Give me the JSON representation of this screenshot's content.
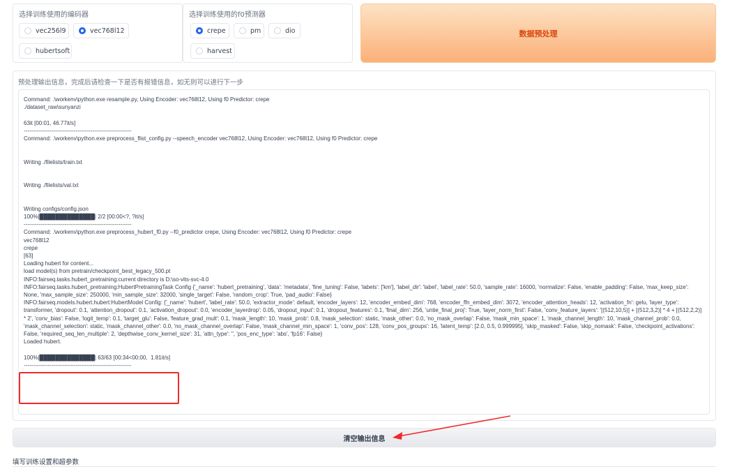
{
  "encoder_group": {
    "label": "选择训练使用的编码器",
    "options": [
      "vec256l9",
      "vec768l12",
      "hubertsoft"
    ],
    "selected": "vec768l12"
  },
  "f0_group": {
    "label": "选择训练使用的f0预测器",
    "options": [
      "crepe",
      "pm",
      "dio",
      "harvest"
    ],
    "selected": "crepe"
  },
  "preprocess_button": {
    "label": "数据预处理"
  },
  "output": {
    "label": "预处理输出信息，完成后请检查一下是否有报错信息，如无则可以进行下一步",
    "log": "Command: .\\workenv\\python.exe resample.py, Using Encoder: vec768l12, Using f0 Predictor: crepe\n./dataset_raw\\sunyanzi\n\n63it [00:01, 46.77it/s]\n----------------------------------------------------------\nCommand: .\\workenv\\python.exe preprocess_flist_config.py --speech_encoder vec768l12, Using Encoder: vec768l12, Using f0 Predictor: crepe\n\n\nWriting ./filelists/train.txt\n\n\nWriting ./filelists/val.txt\n\n\nWriting configs/config.json\n100%|██████████████| 2/2 [00:00<?, ?it/s]\n----------------------------------------------------------\nCommand: .\\workenv\\python.exe preprocess_hubert_f0.py --f0_predictor crepe, Using Encoder: vec768l12, Using f0 Predictor: crepe\nvec768l12\ncrepe\n[63]\nLoading hubert for content...\nload model(s) from pretrain/checkpoint_best_legacy_500.pt\nINFO:fairseq.tasks.hubert_pretraining:current directory is D:\\so-vits-svc-4.0\nINFO:fairseq.tasks.hubert_pretraining:HubertPretrainingTask Config {'_name': 'hubert_pretraining', 'data': 'metadata', 'fine_tuning': False, 'labels': ['km'], 'label_dir': 'label', 'label_rate': 50.0, 'sample_rate': 16000, 'normalize': False, 'enable_padding': False, 'max_keep_size': None, 'max_sample_size': 250000, 'min_sample_size': 32000, 'single_target': False, 'random_crop': True, 'pad_audio': False}\nINFO:fairseq.models.hubert.hubert:HubertModel Config: {'_name': 'hubert', 'label_rate': 50.0, 'extractor_mode': default, 'encoder_layers': 12, 'encoder_embed_dim': 768, 'encoder_ffn_embed_dim': 3072, 'encoder_attention_heads': 12, 'activation_fn': gelu, 'layer_type': transformer, 'dropout': 0.1, 'attention_dropout': 0.1, 'activation_dropout': 0.0, 'encoder_layerdrop': 0.05, 'dropout_input': 0.1, 'dropout_features': 0.1, 'final_dim': 256, 'untie_final_proj': True, 'layer_norm_first': False, 'conv_feature_layers': '[(512,10,5)] + [(512,3,2)] * 4 + [(512,2,2)] * 2', 'conv_bias': False, 'logit_temp': 0.1, 'target_glu': False, 'feature_grad_mult': 0.1, 'mask_length': 10, 'mask_prob': 0.8, 'mask_selection': static, 'mask_other': 0.0, 'no_mask_overlap': False, 'mask_min_space': 1, 'mask_channel_length': 10, 'mask_channel_prob': 0.0, 'mask_channel_selection': static, 'mask_channel_other': 0.0, 'no_mask_channel_overlap': False, 'mask_channel_min_space': 1, 'conv_pos': 128, 'conv_pos_groups': 16, 'latent_temp': [2.0, 0.5, 0.999995], 'skip_masked': False, 'skip_nomask': False, 'checkpoint_activations': False, 'required_seq_len_multiple': 2, 'depthwise_conv_kernel_size': 31, 'attn_type': '', 'pos_enc_type': 'abs', 'fp16': False}\nLoaded hubert.\n\n100%|██████████████| 63/63 [00:34<00:00,  1.81it/s]\n----------------------------------------------------------"
  },
  "clear_button": {
    "label": "清空输出信息"
  },
  "next_section": {
    "label": "填写训练设置和超参数"
  },
  "colors": {
    "accent_blue": "#2563eb",
    "preprocess_text": "#d9480f",
    "highlight_red": "#ef2a2a"
  }
}
